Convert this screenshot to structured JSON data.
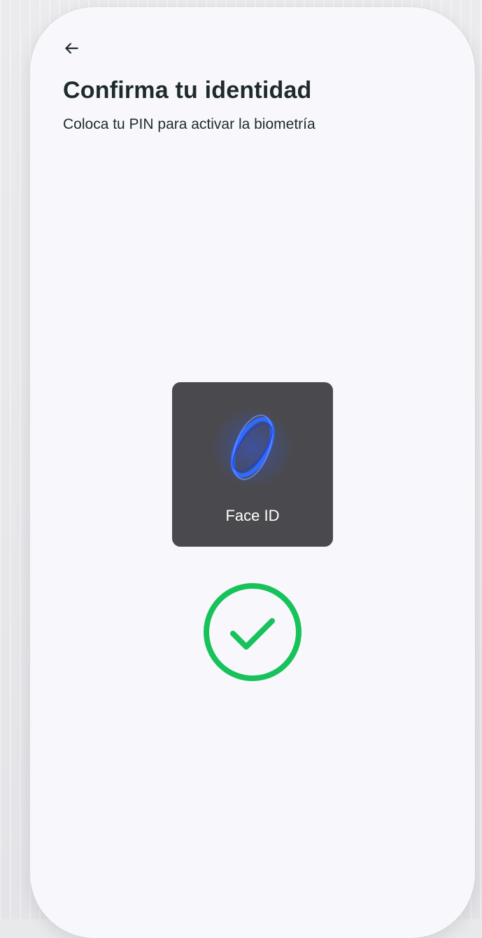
{
  "header": {
    "title": "Confirma tu identidad",
    "subtitle": "Coloca tu PIN para activar la biometría"
  },
  "icons": {
    "back": "arrow-left-icon",
    "faceid": "face-id-icon",
    "success": "checkmark-circle-icon"
  },
  "faceid": {
    "label": "Face ID"
  },
  "colors": {
    "page_bg": "#f8f8fc",
    "title_text": "#1f2a2c",
    "faceid_bg": "#4a4a4e",
    "faceid_glow": "#2f5bff",
    "success": "#18c25b"
  }
}
